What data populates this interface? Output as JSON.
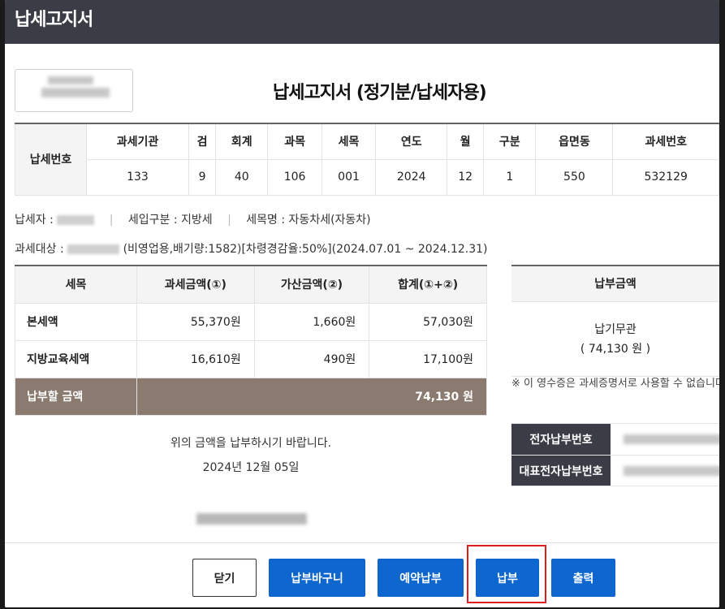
{
  "window": {
    "title": "납세고지서"
  },
  "doc": {
    "title": "납세고지서 (정기분/납세자용)"
  },
  "tax_number": {
    "label": "납세번호",
    "headers": [
      "과세기관",
      "검",
      "회계",
      "과목",
      "세목",
      "연도",
      "월",
      "구분",
      "읍면동",
      "과세번호"
    ],
    "values": [
      "133",
      "9",
      "40",
      "106",
      "001",
      "2024",
      "12",
      "1",
      "550",
      "532129"
    ]
  },
  "info": {
    "taxpayer_label": "납세자 :",
    "income_type": "세입구분 : 지방세",
    "tax_name": "세목명 : 자동차세(자동차)",
    "target_label": "과세대상 :",
    "target_detail": "(비영업용,배기량:1582)[차령경감율:50%](2024.07.01 ~ 2024.12.31)"
  },
  "amounts": {
    "headers": [
      "세목",
      "과세금액(①)",
      "가산금액(②)",
      "합계(①+②)"
    ],
    "rows": [
      {
        "label": "본세액",
        "tax": "55,370원",
        "add": "1,660원",
        "sum": "57,030원"
      },
      {
        "label": "지방교육세액",
        "tax": "16,610원",
        "add": "490원",
        "sum": "17,100원"
      }
    ],
    "total_label": "납부할 금액",
    "total_value": "74,130 원"
  },
  "payment": {
    "header": "납부금액",
    "status": "납기무관",
    "amount": "( 74,130 원 )",
    "note": "※ 이 영수증은 과세증명서로 사용할 수 없습니다"
  },
  "ebill": {
    "e_number_label": "전자납부번호",
    "rep_number_label": "대표전자납부번호"
  },
  "request": {
    "message": "위의 금액을 납부하시기 바랍니다.",
    "date": "2024년 12월 05일"
  },
  "buttons": {
    "close": "닫기",
    "basket": "납부바구니",
    "reserve": "예약납부",
    "pay": "납부",
    "print": "출력"
  },
  "colors": {
    "titlebar": "#3b3d46",
    "primary_button": "#0e66cf",
    "total_row": "#8a7a70",
    "highlight": "#e01d1d"
  }
}
